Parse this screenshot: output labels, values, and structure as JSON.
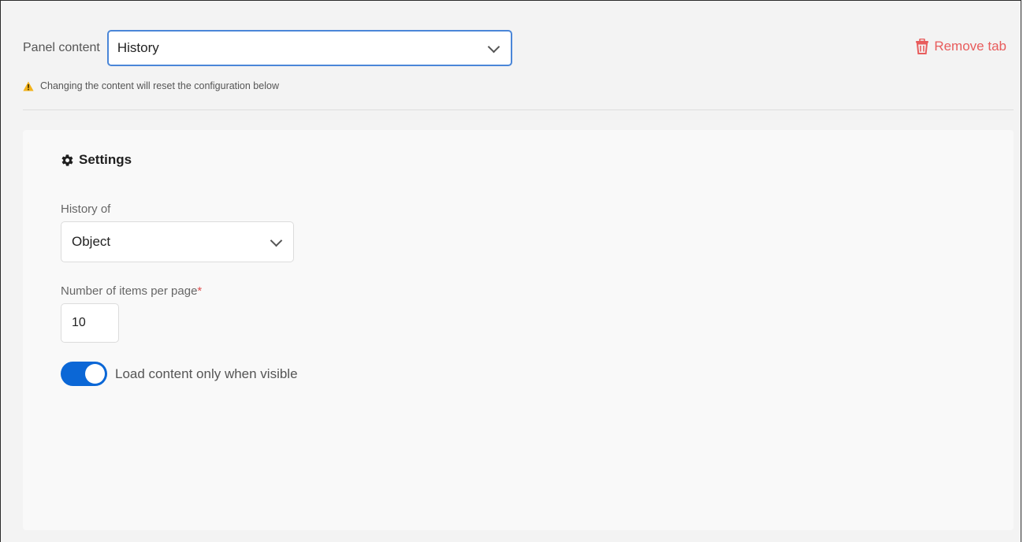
{
  "header": {
    "panel_content_label": "Panel content",
    "panel_content_value": "History",
    "remove_tab_label": "Remove tab",
    "warning_text": "Changing the content will reset the configuration below"
  },
  "settings": {
    "title": "Settings",
    "history_of_label": "History of",
    "history_of_value": "Object",
    "items_per_page_label": "Number of items per page",
    "items_per_page_required": "*",
    "items_per_page_value": "10",
    "load_visible_label": "Load content only when visible",
    "load_visible_enabled": true
  },
  "colors": {
    "accent": "#0b67d6",
    "focus_border": "#4a86d8",
    "danger": "#e85c5c",
    "warning": "#f2b21a"
  },
  "icons": {
    "remove": "trash-icon",
    "warning": "warning-icon",
    "settings": "gear-icon",
    "dropdown": "chevron-down-icon"
  }
}
